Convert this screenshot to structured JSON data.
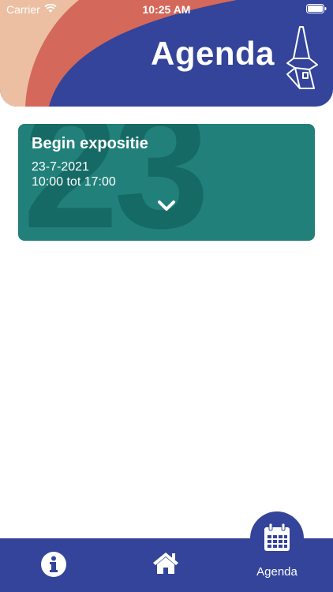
{
  "status_bar": {
    "carrier": "Carrier",
    "time": "10:25 AM"
  },
  "header": {
    "title": "Agenda"
  },
  "events": [
    {
      "day_number": "23",
      "title": "Begin expositie",
      "date": "23-7-2021",
      "time": "10:00 tot 17:00"
    }
  ],
  "tabbar": {
    "items": [
      {
        "icon": "info-icon",
        "label": ""
      },
      {
        "icon": "home-icon",
        "label": ""
      },
      {
        "icon": "calendar-icon",
        "label": "Agenda",
        "active": true
      }
    ]
  },
  "colors": {
    "primary_blue": "#33449a",
    "card_teal": "#22807a",
    "accent_coral": "#d4685a",
    "accent_peach": "#ecbfa3"
  }
}
